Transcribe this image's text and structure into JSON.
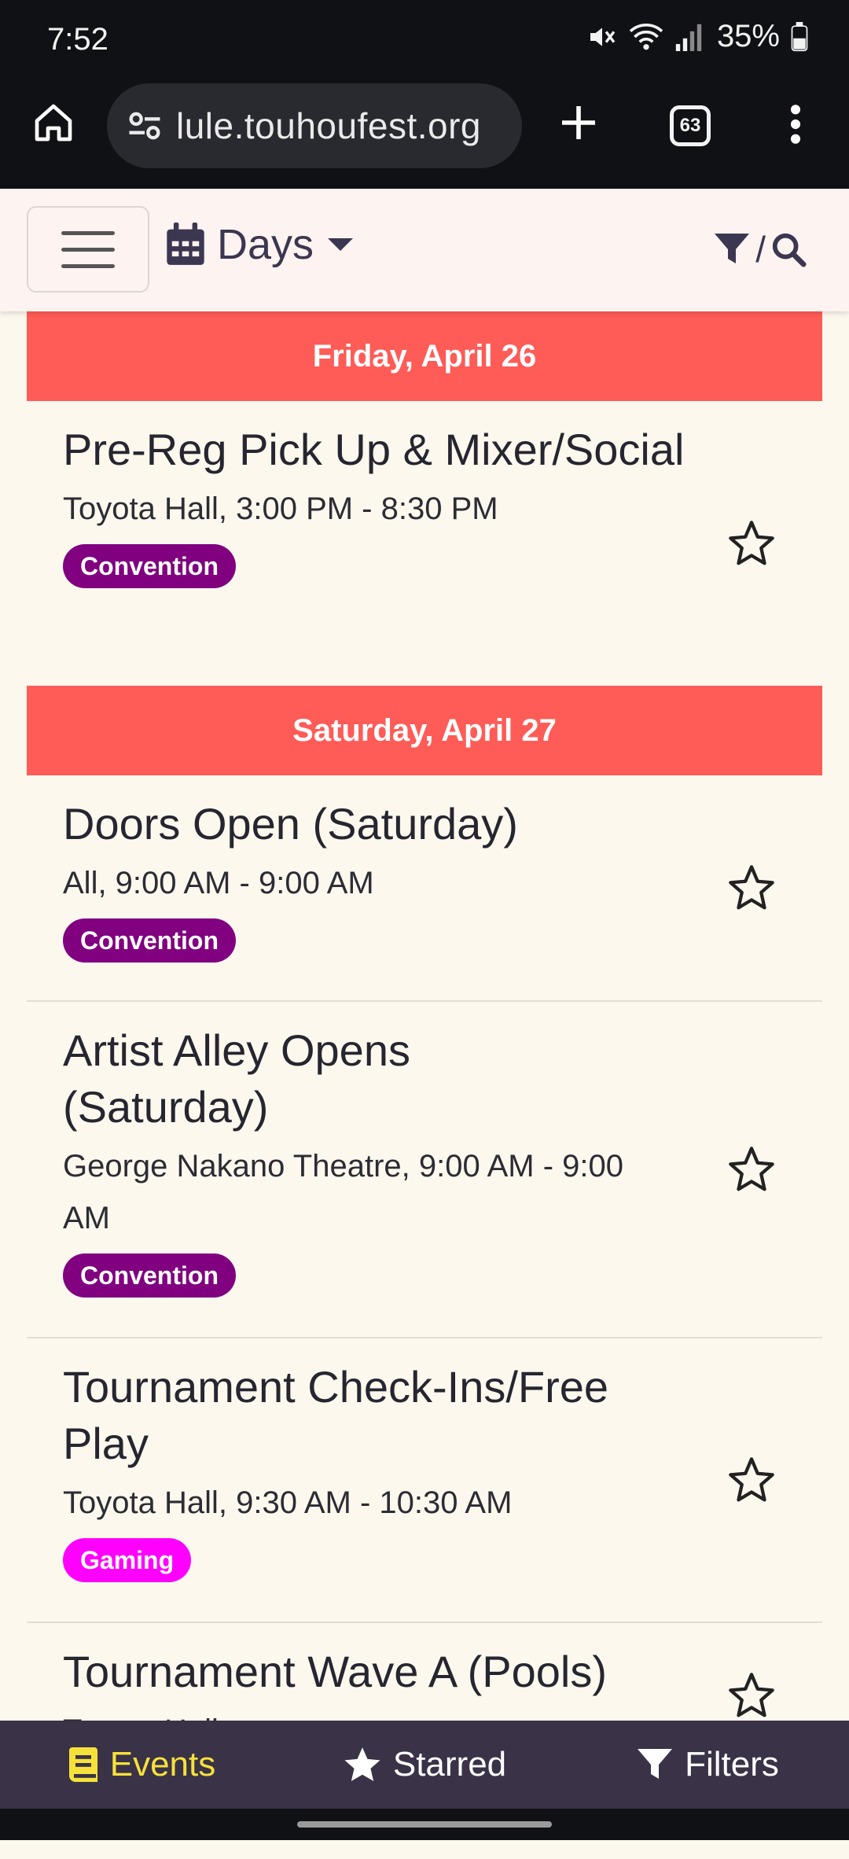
{
  "status_bar": {
    "time": "7:52",
    "battery": "35%"
  },
  "browser": {
    "url": "lule.touhoufest.org",
    "tab_count": "63"
  },
  "header": {
    "view_label": "Days",
    "separator": "/"
  },
  "days": [
    {
      "label": "Friday, April 26",
      "events": [
        {
          "title": "Pre-Reg Pick Up & Mixer/Social",
          "meta": "Toyota Hall, 3:00 PM - 8:30 PM",
          "tag": "Convention"
        }
      ]
    },
    {
      "label": "Saturday, April 27",
      "events": [
        {
          "title": "Doors Open (Saturday)",
          "meta": "All, 9:00 AM - 9:00 AM",
          "tag": "Convention"
        },
        {
          "title": "Artist Alley Opens (Saturday)",
          "meta": "George Nakano Theatre, 9:00 AM - 9:00 AM",
          "tag": "Convention"
        },
        {
          "title": "Tournament Check-Ins/Free Play",
          "meta": "Toyota Hall, 9:30 AM - 10:30 AM",
          "tag": "Gaming"
        },
        {
          "title": "Tournament Wave A (Pools)",
          "meta": "Toyota Hall",
          "tag": ""
        }
      ]
    }
  ],
  "nav": {
    "events": "Events",
    "starred": "Starred",
    "filters": "Filters"
  },
  "colors": {
    "day_header": "#ff5b57",
    "convention": "#800080",
    "gaming": "#ff00ff",
    "nav_bg": "#3a3247",
    "nav_active": "#f6e13a"
  }
}
